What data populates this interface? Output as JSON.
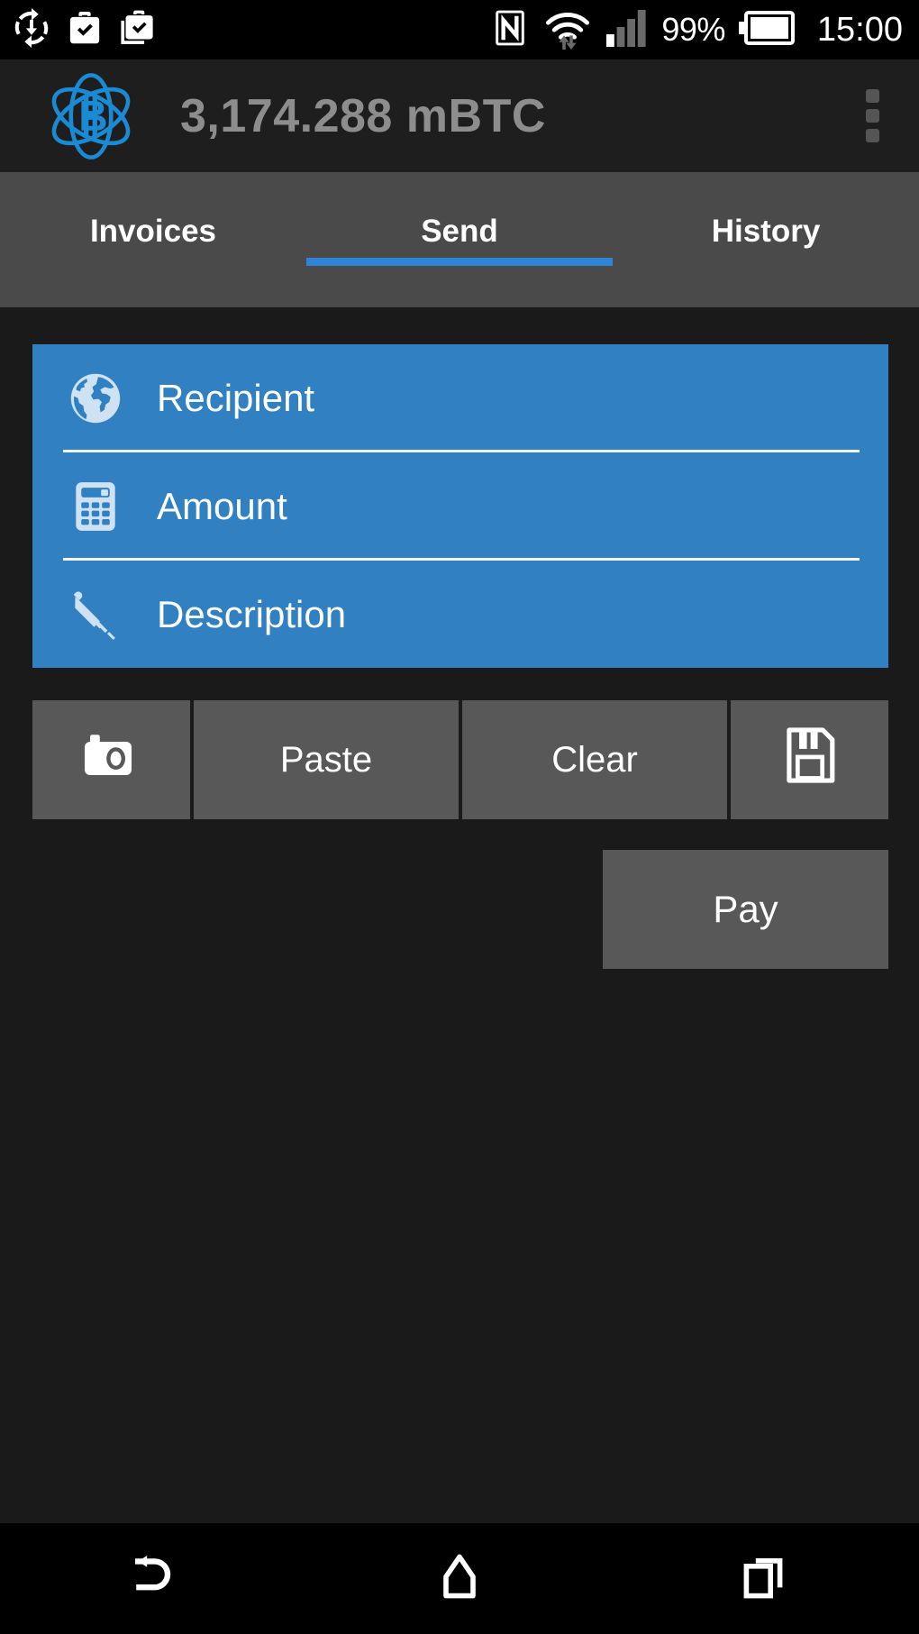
{
  "status_bar": {
    "left_icons": [
      {
        "name": "sync-download-icon"
      },
      {
        "name": "briefcase-check-icon"
      },
      {
        "name": "briefcase-check-stack-icon"
      }
    ],
    "right_icons": [
      {
        "name": "nfc-icon"
      },
      {
        "name": "wifi-transfer-icon"
      },
      {
        "name": "cellular-signal-icon"
      }
    ],
    "battery_percent": "99%",
    "battery_icon": "battery-full-icon",
    "clock": "15:00"
  },
  "app_bar": {
    "logo_icon": "electrum-atom-bitcoin-logo",
    "balance": "3,174.288 mBTC",
    "overflow_icon": "overflow-menu-icon"
  },
  "tabs": [
    {
      "label": "Invoices",
      "active": false
    },
    {
      "label": "Send",
      "active": true
    },
    {
      "label": "History",
      "active": false
    }
  ],
  "form": {
    "fields": [
      {
        "label": "Recipient",
        "value": "",
        "placeholder": "Recipient",
        "icon": "globe-icon"
      },
      {
        "label": "Amount",
        "value": "",
        "placeholder": "Amount",
        "icon": "calculator-icon"
      },
      {
        "label": "Description",
        "value": "",
        "placeholder": "Description",
        "icon": "pen-icon"
      }
    ]
  },
  "actions": [
    {
      "label": "",
      "icon": "camera-icon",
      "name": "scan-qr-button"
    },
    {
      "label": "Paste",
      "icon": "",
      "name": "paste-button"
    },
    {
      "label": "Clear",
      "icon": "",
      "name": "clear-button"
    },
    {
      "label": "",
      "icon": "floppy-save-icon",
      "name": "save-button"
    }
  ],
  "pay_button": {
    "label": "Pay"
  },
  "nav_bar": [
    {
      "name": "back-icon"
    },
    {
      "name": "home-icon"
    },
    {
      "name": "recents-icon"
    }
  ],
  "colors": {
    "accent_blue": "#2f84d8",
    "card_blue": "#3080c2",
    "logo_blue": "#1a8ad4",
    "background": "#1a1a1a",
    "appbar": "#1e1e1e",
    "tabbar": "#4a4a4a",
    "button_gray": "#585858",
    "balance_text": "#8d8d8d"
  }
}
